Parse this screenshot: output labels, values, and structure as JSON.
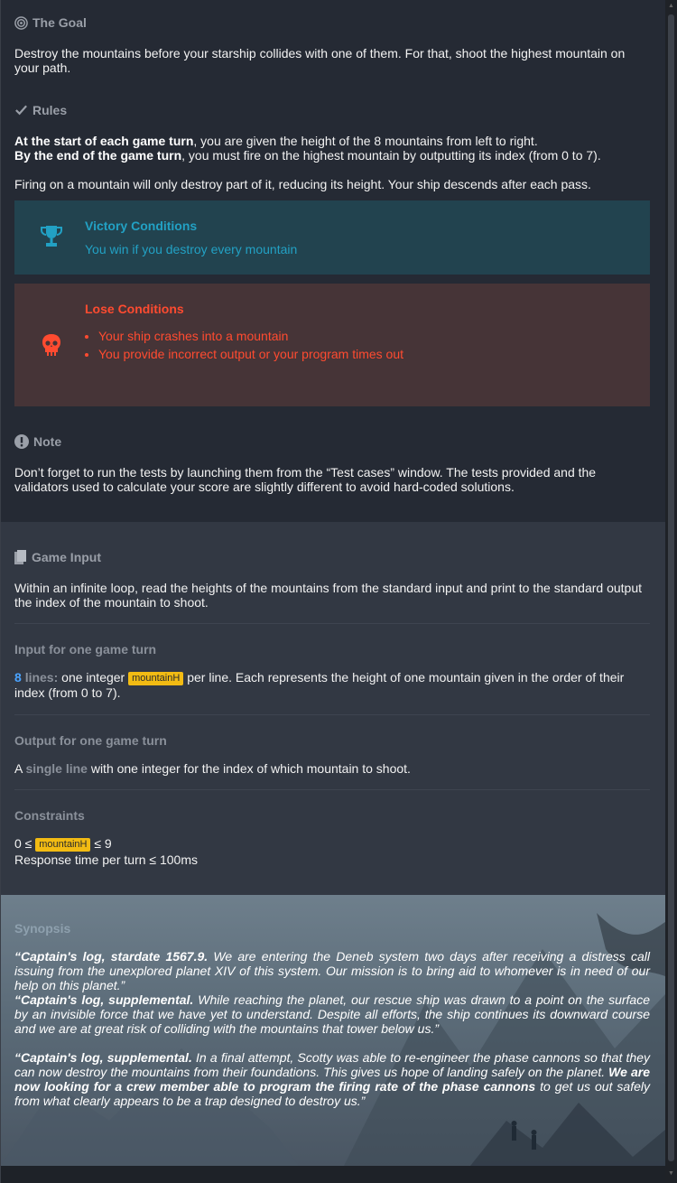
{
  "goal": {
    "title": "The Goal",
    "text": "Destroy the mountains before your starship collides with one of them. For that, shoot the highest mountain on your path."
  },
  "rules": {
    "title": "Rules",
    "line1_bold": "At the start of each game turn",
    "line1_rest": ", you are given the height of the 8 mountains from left to right.",
    "line2_bold": "By the end of the game turn",
    "line2_rest": ", you must fire on the highest mountain by outputting its index (from 0 to 7).",
    "line3": "Firing on a mountain will only destroy part of it, reducing its height. Your ship descends after each pass."
  },
  "victory": {
    "title": "Victory Conditions",
    "text": "You win if you destroy every mountain",
    "color": "#22a1c4"
  },
  "lose": {
    "title": "Lose Conditions",
    "items": [
      "Your ship crashes into a mountain",
      "You provide incorrect output or your program times out"
    ],
    "color": "#ff4b30"
  },
  "note": {
    "title": "Note",
    "text": "Don’t forget to run the tests by launching them from the “Test cases” window. The tests provided and the validators used to calculate your score are slightly different to avoid hard-coded solutions."
  },
  "game_input": {
    "title": "Game Input",
    "text": "Within an infinite loop, read the heights of the mountains from the standard input and print to the standard output the index of the mountain to shoot.",
    "input_title": "Input for one game turn",
    "input_count": "8",
    "input_lines_label": "lines:",
    "input_text_a": "one integer",
    "input_var": "mountainH",
    "input_text_b": "per line. Each represents the height of one mountain given in the order of their index (from 0 to 7).",
    "output_title": "Output for one game turn",
    "output_a": "A",
    "output_single": "single line",
    "output_b": "with one integer for the index of which mountain to shoot.",
    "constraints_title": "Constraints",
    "constraint1_a": "0 ≤",
    "constraint1_var": "mountainH",
    "constraint1_b": "≤ 9",
    "constraint2": "Response time per turn ≤ 100ms"
  },
  "synopsis": {
    "title": "Synopsis",
    "p1_bold": "“Captain's log, stardate 1567.9.",
    "p1_rest": " We are entering the Deneb system two days after receiving a distress call issuing from the unexplored planet XIV of this system. Our mission is to bring aid to whomever is in need of our help on this planet.”",
    "p2_bold": "“Captain's log, supplemental.",
    "p2_rest": " While reaching the planet, our rescue ship was drawn to a point on the surface by an invisible force that we have yet to understand. Despite all efforts, the ship continues its downward course and we are at great risk of colliding with the mountains that tower below us.”",
    "p3_bold": "“Captain's log, supplemental.",
    "p3_mid": " In a final attempt, Scotty was able to re-engineer the phase cannons so that they can now destroy the mountains from their foundations. This gives us hope of landing safely on the planet. ",
    "p3_bold2": "We are now looking for a crew member able to program the firing rate of the phase cannons",
    "p3_end": " to get us out safely from what clearly appears to be a trap designed to destroy us.”"
  }
}
